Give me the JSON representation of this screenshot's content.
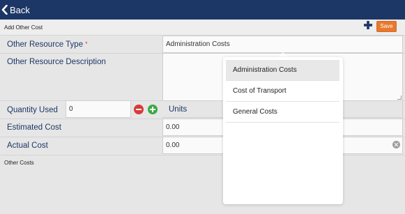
{
  "topbar": {
    "back_label": "Back"
  },
  "subheader": {
    "title": "Add Other Cost",
    "save_label": "Save"
  },
  "form": {
    "resource_type": {
      "label": "Other Resource Type",
      "required_mark": "*",
      "value": "Administration Costs"
    },
    "resource_description": {
      "label": "Other Resource Description",
      "value": ""
    },
    "quantity": {
      "label": "Quantity Used",
      "value": "0",
      "units_label": "Units"
    },
    "estimated_cost": {
      "label": "Estimated Cost",
      "value": "0.00"
    },
    "actual_cost": {
      "label": "Actual Cost",
      "value": "0.00"
    }
  },
  "section": {
    "other_costs_label": "Other Costs"
  },
  "dropdown": {
    "options": [
      {
        "label": "Administration Costs",
        "selected": true
      },
      {
        "label": "Cost of Transport",
        "selected": false
      },
      {
        "label": "General Costs",
        "selected": false
      }
    ]
  },
  "colors": {
    "topbar": "#1c3765",
    "save_button": "#e8792d",
    "label_text": "#1c3765",
    "minus_button": "#d93a3a",
    "plus_button": "#3aaa45"
  },
  "icons": [
    "chevron-left-icon",
    "plus-icon",
    "minus-circle-icon",
    "plus-circle-icon",
    "clear-circle-icon"
  ]
}
